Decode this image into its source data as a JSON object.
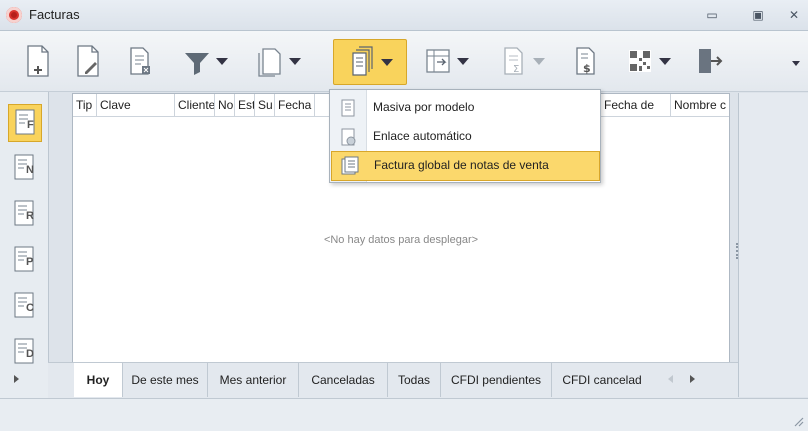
{
  "window": {
    "title": "Facturas"
  },
  "toolbar": {
    "items": [
      {
        "icon": "new-document-icon"
      },
      {
        "icon": "edit-document-icon"
      },
      {
        "icon": "delete-document-icon"
      },
      {
        "icon": "filter-icon"
      },
      {
        "icon": "copy-document-icon"
      },
      {
        "icon": "batch-invoice-icon"
      },
      {
        "icon": "export-icon"
      },
      {
        "icon": "totals-icon"
      },
      {
        "icon": "payment-document-icon"
      },
      {
        "icon": "qr-code-icon"
      },
      {
        "icon": "exit-icon"
      }
    ]
  },
  "sidebar": {
    "items": [
      {
        "label": "F"
      },
      {
        "label": "N"
      },
      {
        "label": "R"
      },
      {
        "label": "P"
      },
      {
        "label": "C"
      },
      {
        "label": "D"
      }
    ]
  },
  "grid": {
    "columns": [
      "Tip",
      "Clave",
      "Cliente",
      "No",
      "Est",
      "Su",
      "Fecha",
      "",
      "Fecha de",
      "Nombre c"
    ],
    "empty_message": "<No hay datos para desplegar>"
  },
  "dropdown": {
    "items": [
      {
        "label": "Masiva por modelo"
      },
      {
        "label": "Enlace automático"
      },
      {
        "label": "Factura global de notas de venta"
      }
    ]
  },
  "tabs": [
    {
      "label": "Hoy"
    },
    {
      "label": "De este mes"
    },
    {
      "label": "Mes anterior"
    },
    {
      "label": "Canceladas"
    },
    {
      "label": "Todas"
    },
    {
      "label": "CFDI pendientes"
    },
    {
      "label": "CFDI cancelad"
    }
  ],
  "colors": {
    "accent": "#f9d35c",
    "logo": "#d8332d"
  }
}
